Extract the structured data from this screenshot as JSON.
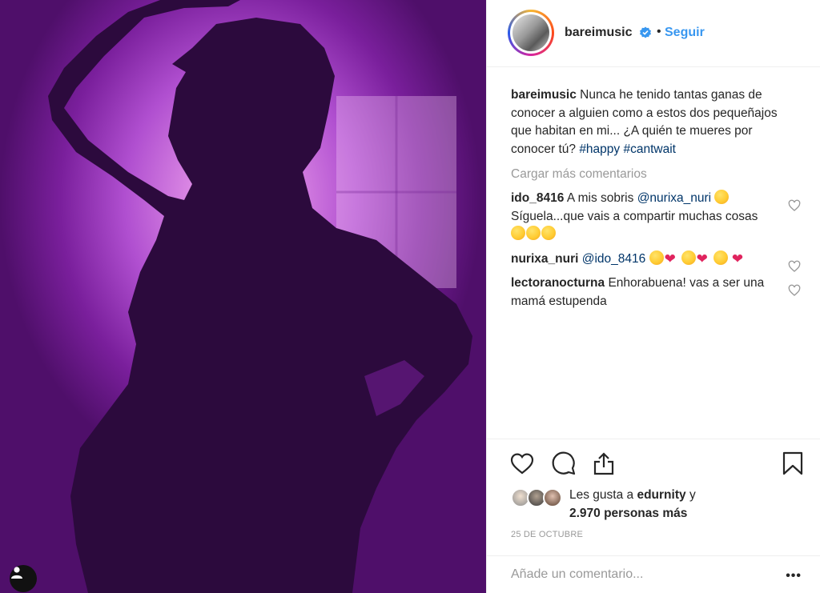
{
  "header": {
    "username": "bareimusic",
    "separator": "•",
    "follow_label": "Seguir"
  },
  "caption": {
    "username": "bareimusic",
    "text": "Nunca he tenido tantas ganas de conocer a alguien como a estos dos pequeñajos que habitan en mi... ¿A quién te mueres por conocer tú?",
    "hashtag1": "#happy",
    "hashtag2": "#cantwait"
  },
  "load_more": "Cargar más comentarios",
  "comments": [
    {
      "username": "ido_8416",
      "mention": "",
      "text_before": "A mis sobris",
      "mention_after": "@nurixa_nuri",
      "text_after": "Síguela...que vais a compartir muchas cosas"
    },
    {
      "username": "nurixa_nuri",
      "mention": "@ido_8416",
      "text": ""
    },
    {
      "username": "lectoranocturna",
      "text": "Enhorabuena! vas a ser una mamá estupenda"
    }
  ],
  "likes": {
    "prefix": "Les gusta a",
    "user": "edurnity",
    "joiner": "y",
    "count": "2.970 personas más"
  },
  "date": "25 DE OCTUBRE",
  "add_comment": {
    "placeholder": "Añade un comentario..."
  },
  "more_label": "•••",
  "icons": [
    "user-tag-icon",
    "verified-badge-icon",
    "heart-icon",
    "comment-icon",
    "share-icon",
    "bookmark-icon",
    "more-icon"
  ],
  "colors": {
    "link": "#3897f0",
    "hashtag": "#003569",
    "muted": "#999999",
    "photo_glow": "#d985e3",
    "photo_dark": "#4f0f6a"
  }
}
